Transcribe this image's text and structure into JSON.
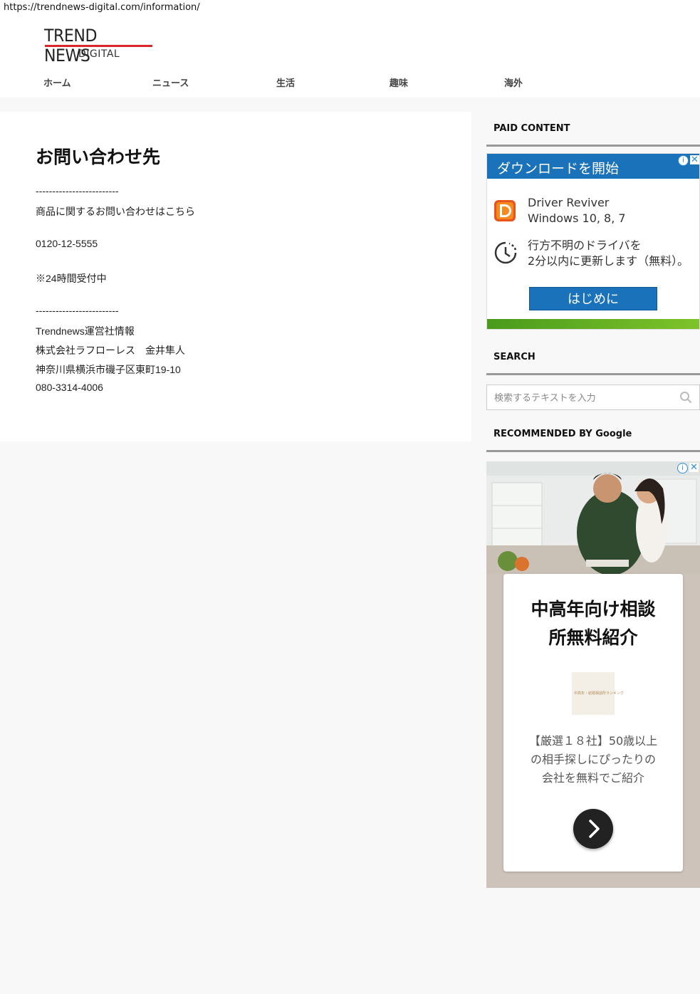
{
  "browser": {
    "url": "https://trendnews-digital.com/information/"
  },
  "logo": {
    "top": "TREND NEWS",
    "bottom": "DIGITAL"
  },
  "nav": {
    "items": [
      "ホーム",
      "ニュース",
      "生活",
      "趣味",
      "海外"
    ]
  },
  "main": {
    "title": "お問い合わせ先",
    "lines": [
      "-------------------------",
      "商品に関するお問い合わせはこちら",
      "0120-12-5555",
      "※24時間受付中",
      "-------------------------",
      "Trendnews運営社情報",
      "株式会社ラフローレス　金井隼人",
      "神奈川県横浜市磯子区東町19-10",
      "080-3314-4006"
    ]
  },
  "sidebar": {
    "paid_title": "PAID CONTENT",
    "ad1": {
      "header": "ダウンロードを開始",
      "product_line1": "Driver Reviver",
      "product_line2": "Windows 10, 8, 7",
      "desc_line1": "行方不明のドライバを",
      "desc_line2": "2分以内に更新します（無料）。",
      "button": "はじめに",
      "choices_icon": "info-icon",
      "close_icon": "close-icon"
    },
    "search_title": "SEARCH",
    "search": {
      "placeholder": "検索するテキストを入力"
    },
    "recommended_title": "RECOMMENDED BY Google",
    "ad2": {
      "headline_line1": "中高年向け相談",
      "headline_line2": "所無料紹介",
      "desc_line1": "【厳選１８社】50歳以上",
      "desc_line2": "の相手探しにぴったりの",
      "desc_line3": "会社を無料でご紹介",
      "thumb_text": "中高年・結婚相談所ランキング"
    }
  }
}
